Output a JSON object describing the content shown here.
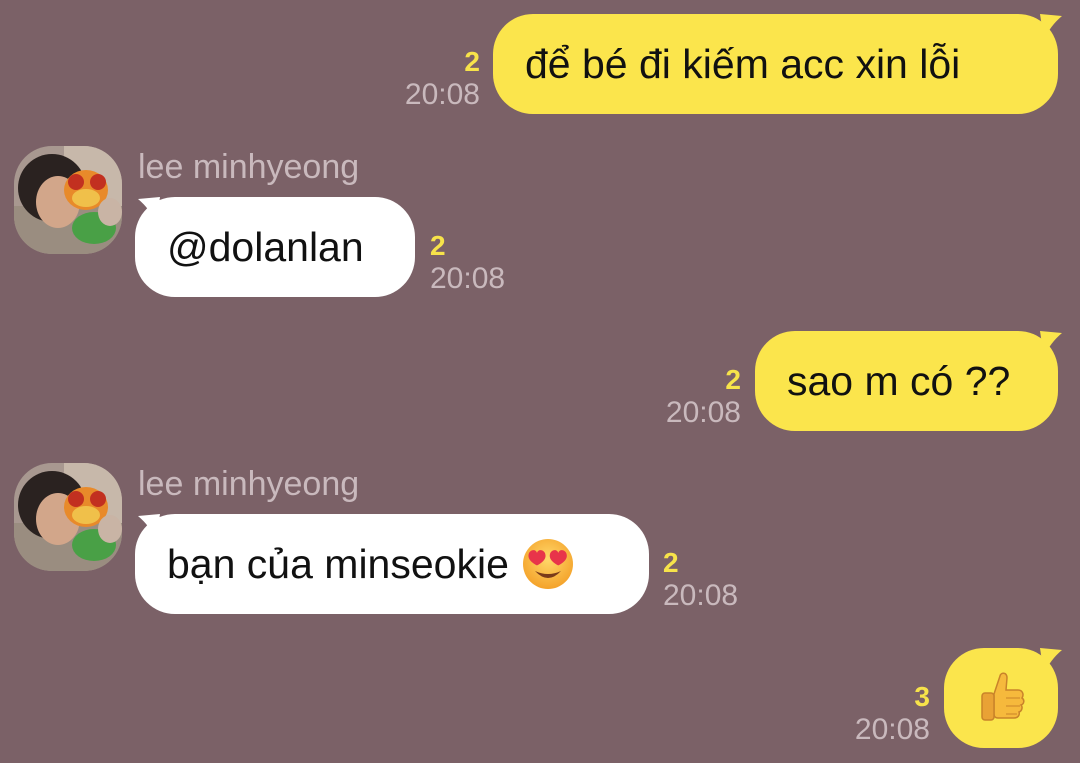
{
  "conversation": {
    "messages": [
      {
        "direction": "outgoing",
        "text": "để bé đi kiếm acc xin lỗi",
        "unread": "2",
        "time": "20:08"
      },
      {
        "direction": "incoming",
        "sender": "lee minhyeong",
        "text": "@dolanlan",
        "unread": "2",
        "time": "20:08"
      },
      {
        "direction": "outgoing",
        "text": "sao m có ??",
        "unread": "2",
        "time": "20:08"
      },
      {
        "direction": "incoming",
        "sender": "lee minhyeong",
        "text": "bạn của minseokie",
        "emoji": "heart-eyes-emoji",
        "unread": "2",
        "time": "20:08"
      },
      {
        "direction": "outgoing",
        "emoji": "thumbs-up-emoji",
        "unread": "3",
        "time": "20:08"
      }
    ]
  },
  "colors": {
    "background": "#7b6167",
    "outgoing_bubble": "#fbe54c",
    "incoming_bubble": "#ffffff",
    "unread_count": "#f7e34a",
    "timestamp": "#c9b9bd"
  }
}
